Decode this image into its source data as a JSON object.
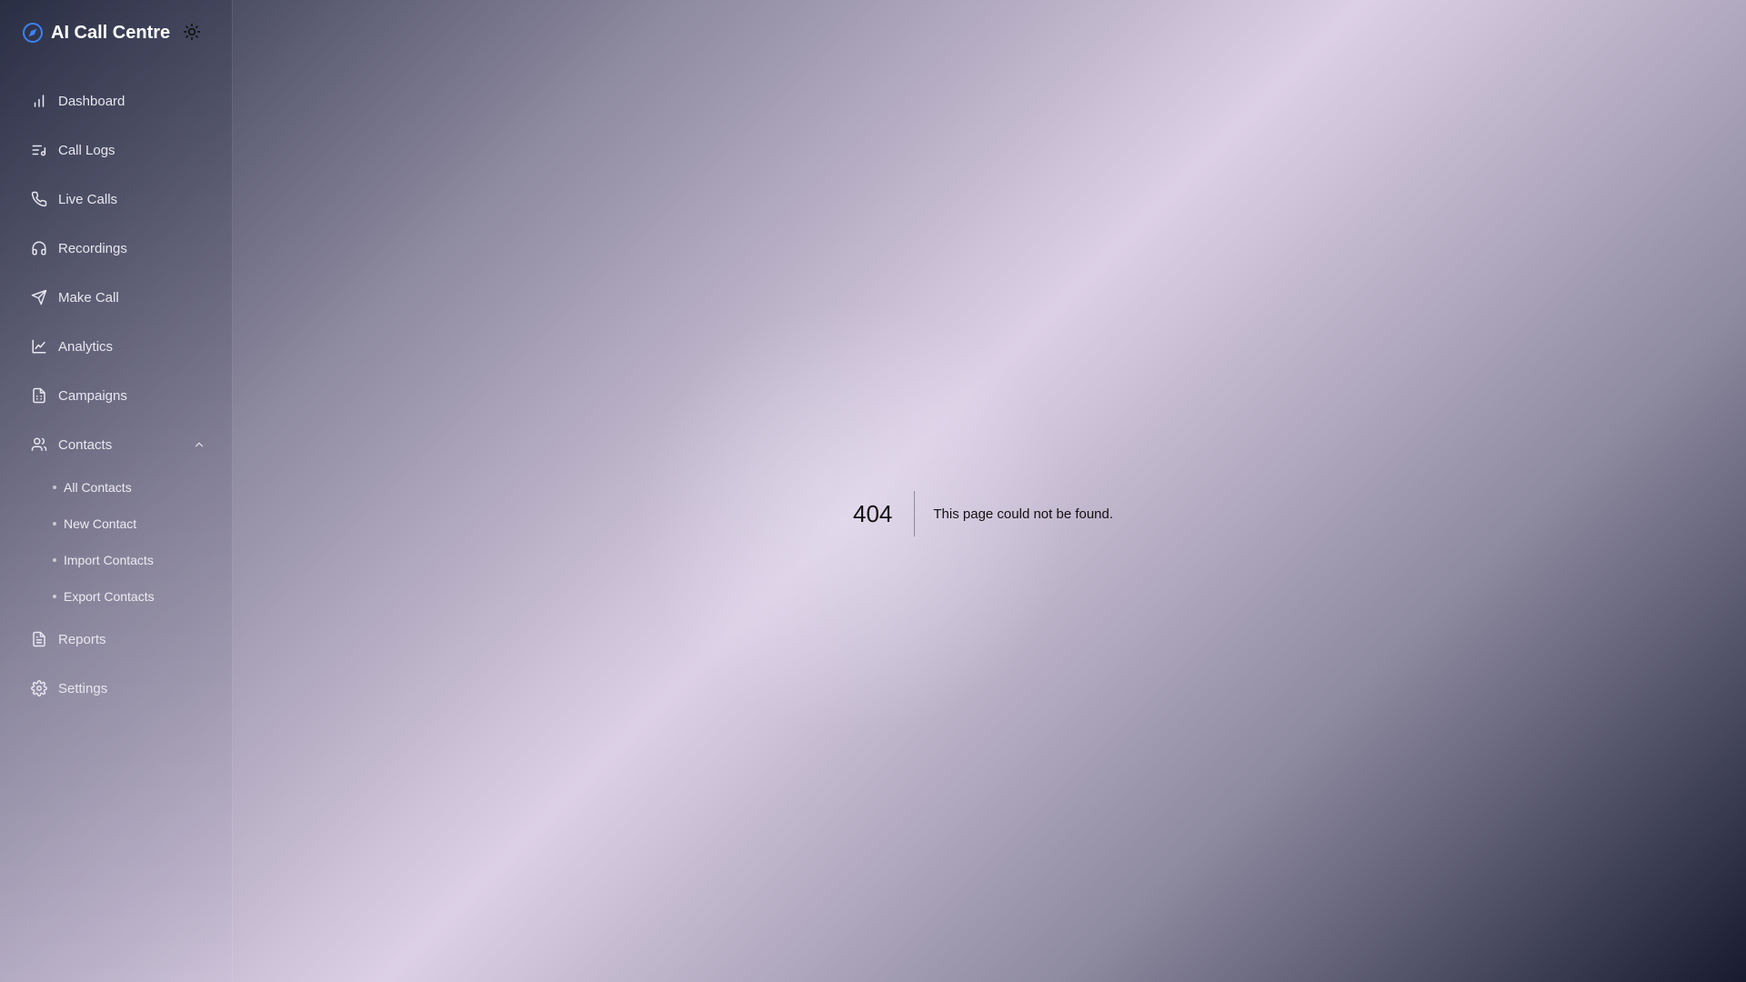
{
  "app": {
    "title": "AI Call Centre",
    "logo_icon": "compass-icon",
    "theme_toggle_icon": "sun-icon"
  },
  "sidebar": {
    "items": [
      {
        "label": "Dashboard",
        "icon": "bar-chart-icon"
      },
      {
        "label": "Call Logs",
        "icon": "list-music-icon"
      },
      {
        "label": "Live Calls",
        "icon": "phone-icon"
      },
      {
        "label": "Recordings",
        "icon": "headphones-icon"
      },
      {
        "label": "Make Call",
        "icon": "send-icon"
      },
      {
        "label": "Analytics",
        "icon": "line-chart-icon"
      },
      {
        "label": "Campaigns",
        "icon": "file-spreadsheet-icon"
      },
      {
        "label": "Contacts",
        "icon": "users-icon",
        "expanded": true,
        "children": [
          "All Contacts",
          "New Contact",
          "Import Contacts",
          "Export Contacts"
        ]
      },
      {
        "label": "Reports",
        "icon": "file-text-icon"
      },
      {
        "label": "Settings",
        "icon": "gear-icon"
      }
    ]
  },
  "main": {
    "error_code": "404",
    "error_message": "This page could not be found."
  },
  "colors": {
    "brand_icon": "#3b82f6",
    "sidebar_text": "#e8e6ef",
    "error_text": "#111111"
  }
}
